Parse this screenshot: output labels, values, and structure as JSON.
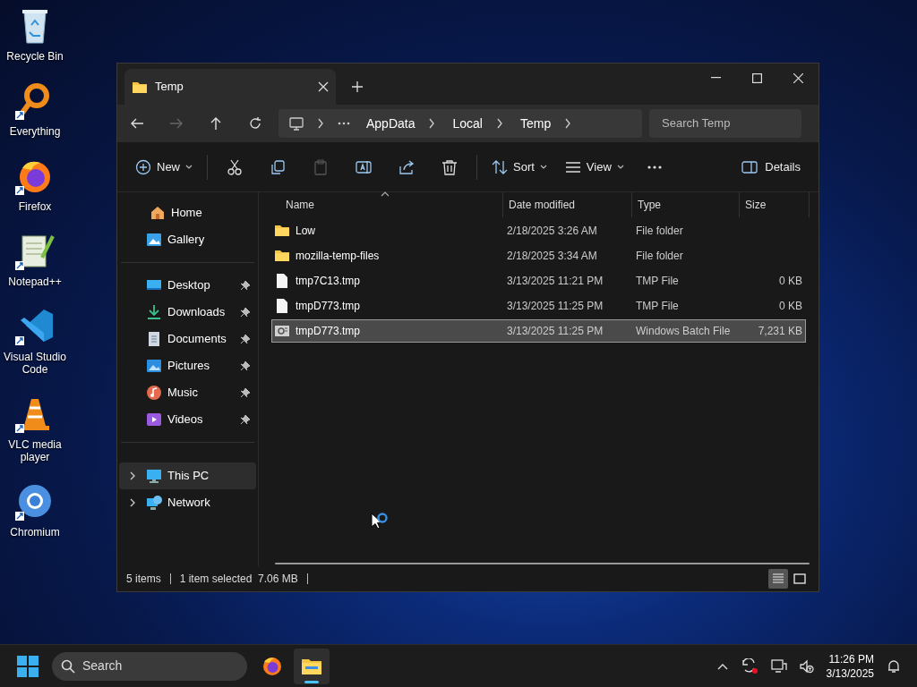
{
  "desktop_icons": [
    {
      "label": "Recycle Bin",
      "kind": "recycle",
      "shortcut": false
    },
    {
      "label": "Everything",
      "kind": "search",
      "shortcut": true
    },
    {
      "label": "Firefox",
      "kind": "firefox",
      "shortcut": true
    },
    {
      "label": "Notepad++",
      "kind": "notepad",
      "shortcut": true
    },
    {
      "label": "Visual Studio Code",
      "kind": "vscode",
      "shortcut": true
    },
    {
      "label": "VLC media player",
      "kind": "vlc",
      "shortcut": true
    },
    {
      "label": "Chromium",
      "kind": "chromium",
      "shortcut": true
    }
  ],
  "window": {
    "tab_title": "Temp",
    "address": {
      "segments": [
        "AppData",
        "Local",
        "Temp"
      ]
    },
    "search": {
      "placeholder": "Search Temp"
    },
    "toolbar": [
      {
        "kind": "new",
        "label": "New",
        "disabled": false
      },
      {
        "kind": "cut",
        "disabled": false
      },
      {
        "kind": "copy",
        "disabled": false
      },
      {
        "kind": "paste",
        "disabled": true
      },
      {
        "kind": "rename",
        "disabled": false
      },
      {
        "kind": "share",
        "disabled": false
      },
      {
        "kind": "delete",
        "disabled": false
      },
      {
        "kind": "sort",
        "label": "Sort",
        "disabled": false
      },
      {
        "kind": "view",
        "label": "View",
        "disabled": false
      },
      {
        "kind": "more",
        "disabled": false
      }
    ],
    "details_button": {
      "label": "Details"
    },
    "sidebar": [
      [
        {
          "label": "Home",
          "kind": "home",
          "selected": false
        },
        {
          "label": "Gallery",
          "kind": "gallery",
          "selected": false
        }
      ],
      [
        {
          "label": "Desktop",
          "kind": "desktop",
          "pinned": true,
          "selected": false
        },
        {
          "label": "Downloads",
          "kind": "downloads",
          "pinned": true,
          "selected": false
        },
        {
          "label": "Documents",
          "kind": "documents",
          "pinned": true,
          "selected": false
        },
        {
          "label": "Pictures",
          "kind": "pictures",
          "pinned": true,
          "selected": false
        },
        {
          "label": "Music",
          "kind": "music",
          "pinned": true,
          "selected": false
        },
        {
          "label": "Videos",
          "kind": "videos",
          "pinned": true,
          "selected": false
        }
      ],
      [
        {
          "label": "This PC",
          "kind": "pc",
          "expanded": false,
          "selected": true
        },
        {
          "label": "Network",
          "kind": "network",
          "expanded": false,
          "selected": false
        }
      ]
    ],
    "table": {
      "columns": [
        {
          "label": "Name",
          "sorted": true
        },
        {
          "label": "Date modified",
          "sorted": false
        },
        {
          "label": "Type",
          "sorted": false
        },
        {
          "label": "Size",
          "sorted": false
        }
      ],
      "rows": [
        {
          "kind": "folder",
          "name": "Low",
          "date": "2/18/2025 3:26 AM",
          "type": "File folder",
          "selected": false
        },
        {
          "kind": "folder",
          "name": "mozilla-temp-files",
          "date": "2/18/2025 3:34 AM",
          "type": "File folder",
          "selected": false
        },
        {
          "kind": "file",
          "name": "tmp7C13.tmp",
          "date": "3/13/2025 11:21 PM",
          "type": "TMP File",
          "size": "0 KB",
          "selected": false
        },
        {
          "kind": "file",
          "name": "tmpD773.tmp",
          "date": "3/13/2025 11:25 PM",
          "type": "TMP File",
          "size": "0 KB",
          "selected": false
        },
        {
          "kind": "batch",
          "name": "tmpD773.tmp",
          "date": "3/13/2025 11:25 PM",
          "type": "Windows Batch File",
          "size": "7,231 KB",
          "selected": true
        }
      ]
    },
    "status_bar": [
      "5 items",
      "1 item selected  7.06 MB"
    ],
    "view_modes": [
      {
        "kind": "details",
        "selected": true
      },
      {
        "kind": "tiles",
        "selected": false
      }
    ]
  },
  "taskbar": {
    "search": {
      "placeholder": "Search"
    },
    "apps": [
      {
        "kind": "firefox",
        "selected": false
      },
      {
        "kind": "explorer",
        "selected": true
      }
    ],
    "time": "11:26 PM",
    "date": "3/13/2025"
  }
}
